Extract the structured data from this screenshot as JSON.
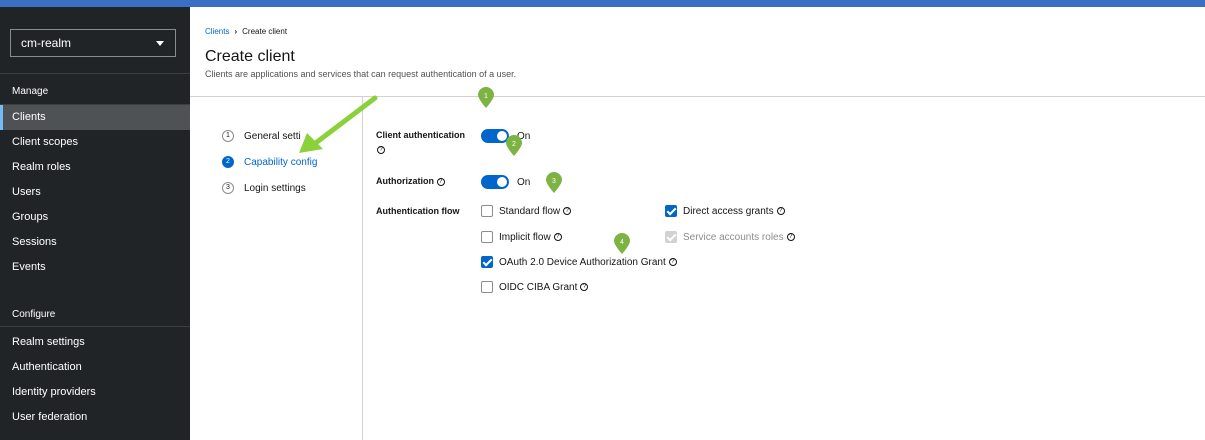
{
  "sidebar": {
    "realm": "cm-realm",
    "manage_heading": "Manage",
    "configure_heading": "Configure",
    "manage_items": [
      "Clients",
      "Client scopes",
      "Realm roles",
      "Users",
      "Groups",
      "Sessions",
      "Events"
    ],
    "configure_items": [
      "Realm settings",
      "Authentication",
      "Identity providers",
      "User federation"
    ],
    "active_item": "Clients"
  },
  "breadcrumb": {
    "parent": "Clients",
    "current": "Create client"
  },
  "page": {
    "title": "Create client",
    "description": "Clients are applications and services that can request authentication of a user."
  },
  "wizard": {
    "steps": [
      {
        "num": "1",
        "label": "General setti"
      },
      {
        "num": "2",
        "label": "Capability config"
      },
      {
        "num": "3",
        "label": "Login settings"
      }
    ],
    "current_step": 2
  },
  "form": {
    "client_auth_label": "Client authentication",
    "client_auth_state": "On",
    "authorization_label": "Authorization",
    "authorization_state": "On",
    "auth_flow_label": "Authentication flow",
    "help_glyph": "?",
    "flows": {
      "standard": {
        "label": "Standard flow",
        "checked": false
      },
      "direct": {
        "label": "Direct access grants",
        "checked": true
      },
      "implicit": {
        "label": "Implicit flow",
        "checked": false
      },
      "service": {
        "label": "Service accounts roles",
        "checked": true,
        "disabled": true
      },
      "device": {
        "label": "OAuth 2.0 Device Authorization Grant",
        "checked": true
      },
      "ciba": {
        "label": "OIDC CIBA Grant",
        "checked": false
      }
    }
  },
  "annotations": {
    "pin_labels": [
      "1",
      "2",
      "3",
      "4"
    ],
    "pin_color": "#7cb342",
    "arrow_color": "#8bd13a"
  },
  "colors": {
    "accent": "#0066cc",
    "sidebar_bg": "#212427",
    "topbar": "#3a6fc4"
  }
}
